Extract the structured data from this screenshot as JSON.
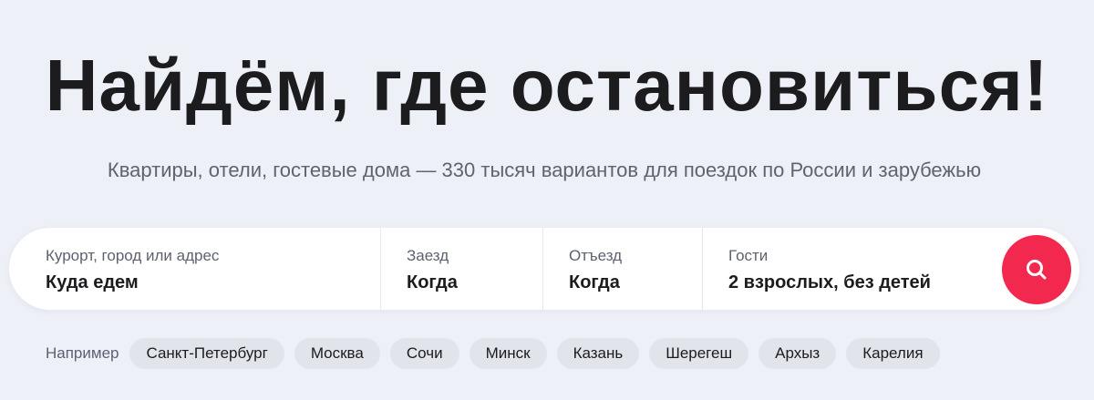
{
  "hero": {
    "title": "Найдём, где остановиться!",
    "subtitle": "Квартиры, отели, гостевые дома — 330 тысяч вариантов для поездок по России и зарубежью"
  },
  "search": {
    "destination": {
      "label": "Курорт, город или адрес",
      "value": "Куда едем"
    },
    "checkin": {
      "label": "Заезд",
      "value": "Когда"
    },
    "checkout": {
      "label": "Отъезд",
      "value": "Когда"
    },
    "guests": {
      "label": "Гости",
      "value": "2 взрослых, без детей"
    },
    "button_icon": "search-icon"
  },
  "suggestions": {
    "label": "Например",
    "items": [
      "Санкт-Петербург",
      "Москва",
      "Сочи",
      "Минск",
      "Казань",
      "Шерегеш",
      "Архыз",
      "Карелия"
    ]
  },
  "colors": {
    "background": "#eef0f8",
    "accent": "#f2284f",
    "chip": "#e2e4ec",
    "text": "#1c1c1e",
    "muted": "#5d6170"
  }
}
